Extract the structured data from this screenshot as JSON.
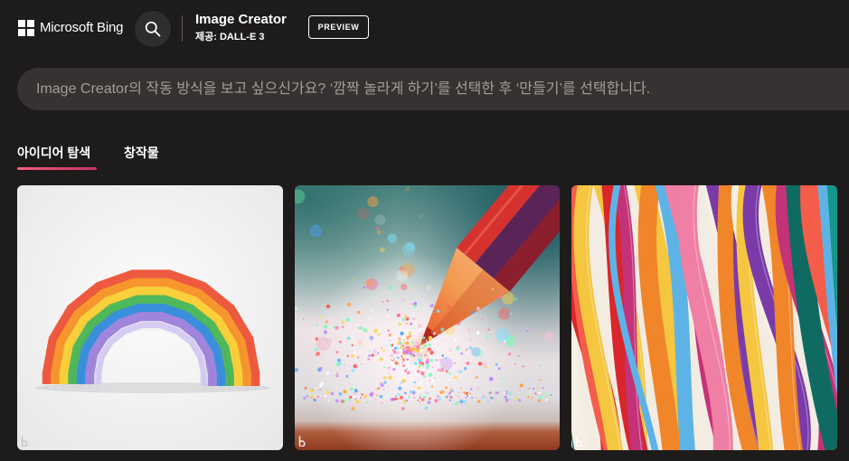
{
  "header": {
    "brand": "Microsoft Bing",
    "title": "Image Creator",
    "subtitle": "제공: DALL-E 3",
    "preview_label": "PREVIEW",
    "icons": {
      "logo": "microsoft-logo-icon",
      "search": "search-icon"
    }
  },
  "search": {
    "placeholder": "Image Creator의 작동 방식을 보고 싶으신가요? ‘깜짝 놀라게 하기’를 선택한 후 ‘만들기’를 선택합니다."
  },
  "tabs": [
    {
      "label": "아이디어 탐색",
      "active": true
    },
    {
      "label": "창작물",
      "active": false
    }
  ],
  "theme": {
    "background": "#1e1c1b",
    "search_bar": "#353231",
    "placeholder": "#a19e9c",
    "text": "#ffffff",
    "tab_underline": [
      "#f2617a",
      "#c8356b"
    ]
  }
}
